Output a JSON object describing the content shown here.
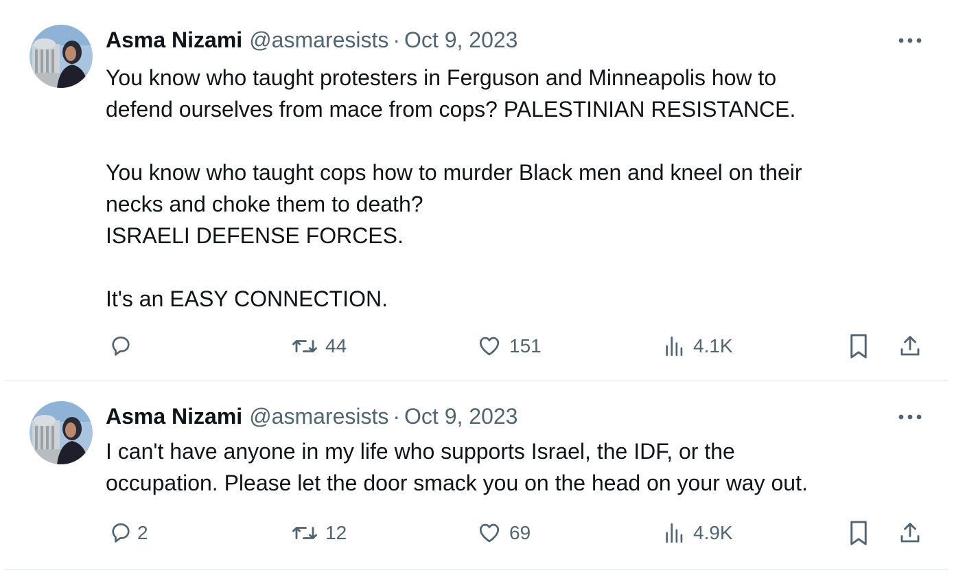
{
  "tweets": [
    {
      "author": {
        "name": "Asma Nizami",
        "handle": "@asmaresists",
        "avatar_icon": "profile-photo"
      },
      "separator": "·",
      "date": "Oct 9, 2023",
      "lines": [
        "You know who taught protesters in Ferguson and Minneapolis how to",
        "defend ourselves from mace from cops? PALESTINIAN RESISTANCE.",
        "",
        "You know who taught cops how to murder Black men and kneel on their",
        "necks and choke them to death?",
        "ISRAELI DEFENSE FORCES.",
        "",
        "It's an EASY CONNECTION."
      ],
      "actions": {
        "replies": "",
        "reposts": "44",
        "likes": "151",
        "views": "4.1K"
      }
    },
    {
      "author": {
        "name": "Asma Nizami",
        "handle": "@asmaresists",
        "avatar_icon": "profile-photo"
      },
      "separator": "·",
      "date": "Oct 9, 2023",
      "lines": [
        "I can't have anyone in my life who supports Israel, the IDF, or the",
        "occupation. Please let the door smack you on the head on your way out."
      ],
      "actions": {
        "replies": "2",
        "reposts": "12",
        "likes": "69",
        "views": "4.9K"
      }
    }
  ],
  "icons": {
    "reply": "reply-icon",
    "repost": "repost-icon",
    "like": "heart-icon",
    "views": "analytics-icon",
    "bookmark": "bookmark-icon",
    "share": "share-icon",
    "more": "more-icon"
  },
  "colors": {
    "text": "#0f1419",
    "secondary": "#536471",
    "border": "#eff3f4"
  }
}
